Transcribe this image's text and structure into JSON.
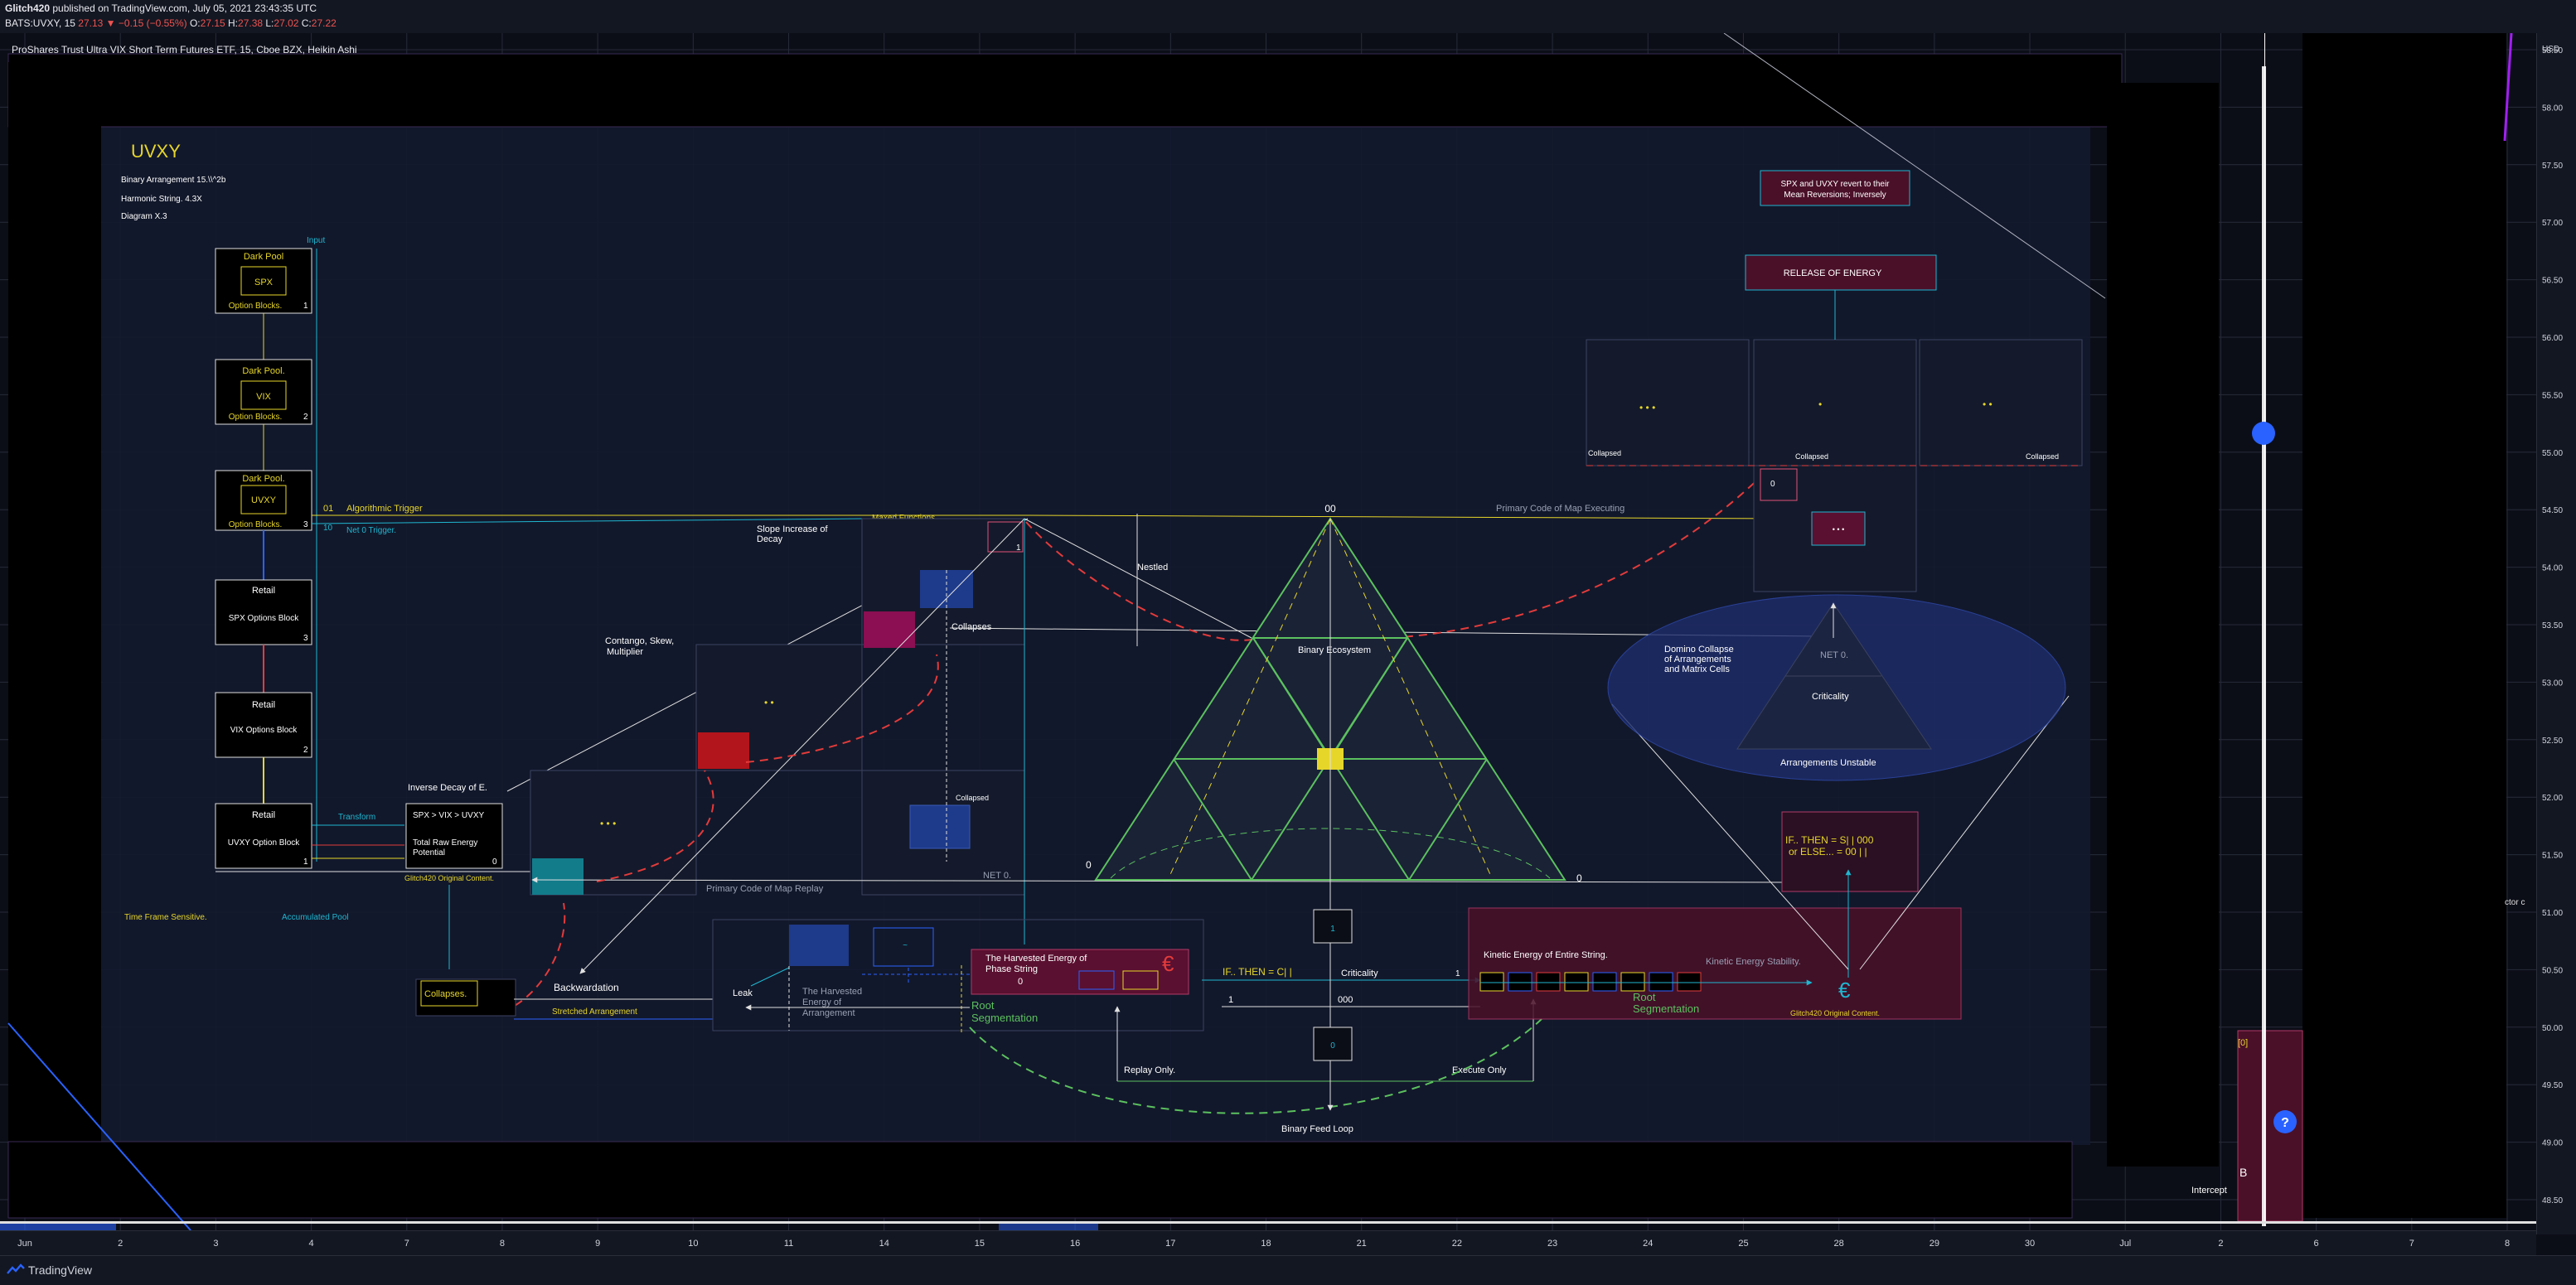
{
  "header": {
    "author": "Glitch420",
    "published": " published on TradingView.com, July 05, 2021 23:43:35 UTC",
    "symbol": "BATS:UVXY, 15",
    "price": "27.13",
    "change": "−0.15 (−0.55%)",
    "o": "27.15",
    "h": "27.38",
    "l": "27.02",
    "c": "27.22"
  },
  "footer": {
    "brand": "TradingView"
  },
  "colors": {
    "bg": "#0c0e17",
    "grid": "#262b3a",
    "yellow": "#e7d62a",
    "cyan": "#1fb6d0",
    "green": "#5cc15f",
    "pink": "#e0527a",
    "red": "#e33b3b"
  },
  "chart_data": {
    "type": "table",
    "title": "ProShares Trust Ultra VIX Short Term Futures ETF, 15, Cboe BZX, Heikin Ashi",
    "currency": "USD",
    "y_ticks": [
      "58.50",
      "58.00",
      "57.50",
      "57.00",
      "56.50",
      "56.00",
      "55.50",
      "55.00",
      "54.50",
      "54.00",
      "53.50",
      "53.00",
      "52.50",
      "52.00",
      "51.50",
      "51.00",
      "50.50",
      "50.00",
      "49.50",
      "49.00",
      "48.50"
    ],
    "x_ticks": [
      "Jun",
      "2",
      "3",
      "4",
      "7",
      "8",
      "9",
      "10",
      "11",
      "14",
      "15",
      "16",
      "17",
      "18",
      "21",
      "22",
      "23",
      "24",
      "25",
      "28",
      "29",
      "30",
      "Jul",
      "2",
      "6",
      "7",
      "8"
    ],
    "ylim": [
      48.3,
      59.0
    ],
    "grid": true
  },
  "diagram": {
    "title": "UVXY",
    "subtitle1": "Binary Arrangement 15.\\\\^2b",
    "subtitle2": "Harmonic String. 4.3X",
    "subtitle3": "Diagram X.3",
    "input": "Input",
    "dark_pools": [
      {
        "title": "Dark Pool",
        "inner": "SPX",
        "sub": "Option Blocks.",
        "n": "1"
      },
      {
        "title": "Dark Pool.",
        "inner": "VIX",
        "sub": "Option Blocks.",
        "n": "2"
      },
      {
        "title": "Dark Pool.",
        "inner": "UVXY",
        "sub": "Option Blocks.",
        "n": "3"
      }
    ],
    "retail": [
      {
        "title": "Retail",
        "sub": "SPX Options Block",
        "n": "3"
      },
      {
        "title": "Retail",
        "sub": "VIX Options Block",
        "n": "2"
      },
      {
        "title": "Retail",
        "sub": "UVXY Option Block",
        "n": "1"
      }
    ],
    "trig01": "01",
    "algo_trigger": "Algorithmic Trigger",
    "trig10": "10",
    "net0_trigger": "Net 0 Trigger.",
    "transform": "Transform",
    "energy_box_l1": "SPX > VIX > UVXY",
    "energy_box_l2": "Total Raw Energy",
    "energy_box_l3": "Potential",
    "energy_box_n": "0",
    "orig_content": "Glitch420 Original Content.",
    "time_frame": "Time Frame Sensitive.",
    "accum_pool": "Accumulated Pool",
    "inverse_decay": "Inverse Decay of E.",
    "contango": "Contango, Skew,",
    "multiplier": "Multiplier",
    "slope1": "Slope Increase of",
    "slope2": "Decay",
    "maxed": "Maxed Functions",
    "nestled": "Nestled",
    "collapses": "Collapses",
    "collapsed": "Collapsed",
    "one": "1",
    "net0": "NET 0.",
    "dots3": "• • •",
    "dots2": "• •",
    "dot1": "•",
    "primary_replay": "Primary Code of Map Replay",
    "primary_exec": "Primary Code of Map Executing",
    "collapses_box": "Collapses.",
    "backwardation": "Backwardation",
    "stretched": "Stretched Arrangement",
    "leak": "Leak",
    "harvest_arr1": "The Harvested",
    "harvest_arr2": "Energy of",
    "harvest_arr3": "Arrangement",
    "harvest_phase1": "The Harvested Energy of",
    "harvest_phase2": "Phase String",
    "zero": "0",
    "euro": "€",
    "root1": "Root",
    "root2": "Segmentation",
    "if_then_c": "IF.. THEN = C| |",
    "criticality": "Criticality",
    "c000": "000",
    "replay_only": "Replay Only.",
    "execute_only": "Execute Only",
    "binary_feed": "Binary Feed Loop",
    "binary_eco": "Binary Ecosystem",
    "top00": "00",
    "kinetic1": "Kinetic Energy of Entire String.",
    "kinetic2": "Kinetic Energy Stability.",
    "orig_content2": "Glitch420 Original Content.",
    "if_then_s1": "IF.. THEN = S| | 000",
    "if_then_s2": "or ELSE... = 00 | |",
    "domino1": "Domino Collapse",
    "domino2": "of Arrangements",
    "domino3": "and Matrix Cells",
    "arr_unstable": "Arrangements Unstable",
    "release": "RELEASE OF ENERGY",
    "spx_uvxy1": "SPX and UVXY revert to their",
    "spx_uvxy2": "Mean Reversions; Inversely",
    "intercept": "Intercept",
    "b_label": "B",
    "zero_bracket": "[0]",
    "cut_label": "ctor c"
  }
}
